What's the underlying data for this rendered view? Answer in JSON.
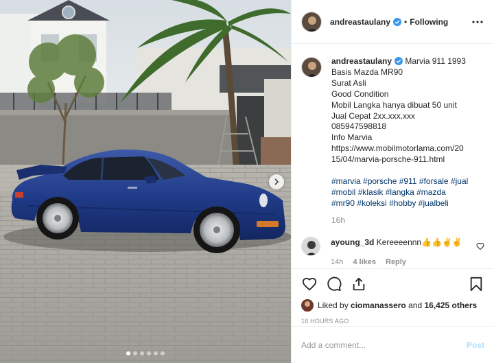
{
  "header": {
    "username": "andreastaulany",
    "separator": "•",
    "follow_status": "Following",
    "more_icon": "more-options-icon"
  },
  "caption": {
    "username": "andreastaulany",
    "lines": [
      "Marvia 911 1993",
      "Basis Mazda MR90",
      "Surat Asli",
      "Good Condition",
      "Mobil Langka hanya dibuat 50 unit",
      "Jual Cepat 2xx.xxx.xxx",
      "085947598818",
      "Info Marvia",
      "https://www.mobilmotorlama.com/20",
      "15/04/marvia-porsche-911.html"
    ],
    "hashtag_lines": [
      [
        "#marvia",
        "#porsche",
        "#911",
        "#forsale",
        "#jual"
      ],
      [
        "#mobil",
        "#klasik",
        "#langka",
        "#mazda"
      ],
      [
        "#mr90",
        "#koleksi",
        "#hobby",
        "#jualbeli"
      ]
    ],
    "time": "16h"
  },
  "comment": {
    "username": "ayoung_3d",
    "text": "Kereeeennn👍👍✌✌",
    "time": "14h",
    "likes": "4 likes",
    "reply": "Reply"
  },
  "likes": {
    "prefix": "Liked by",
    "liker": "ciomanassero",
    "connector": "and",
    "count": "16,425 others"
  },
  "date": "16 HOURS AGO",
  "add_comment": {
    "placeholder": "Add a comment...",
    "post_label": "Post"
  },
  "colors": {
    "link": "#003569",
    "secondary": "#8e8e8e",
    "post_disabled": "#b2dffc",
    "verified": "#3897f0"
  },
  "carousel": {
    "slides": 6,
    "active_index": 0
  }
}
